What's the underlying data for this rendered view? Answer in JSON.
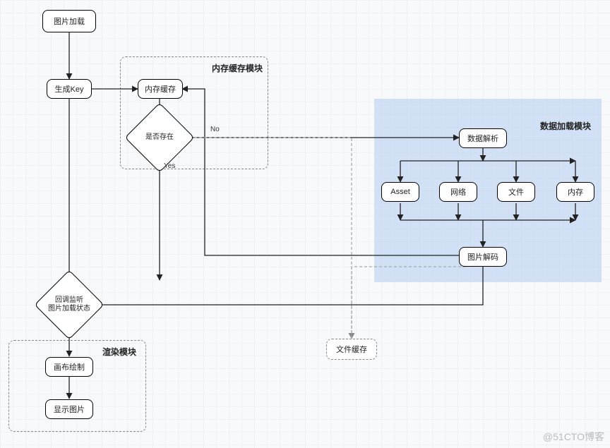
{
  "chart_data": {
    "type": "flowchart",
    "nodes": [
      {
        "id": "start",
        "shape": "rounded-rect",
        "label": "图片加载"
      },
      {
        "id": "genkey",
        "shape": "rounded-rect",
        "label": "生成Key"
      },
      {
        "id": "memcache",
        "shape": "rounded-rect",
        "label": "内存缓存"
      },
      {
        "id": "exists",
        "shape": "diamond",
        "label": "是否存在"
      },
      {
        "id": "parse",
        "shape": "rounded-rect",
        "label": "数据解析"
      },
      {
        "id": "asset",
        "shape": "rounded-rect",
        "label": "Asset"
      },
      {
        "id": "network",
        "shape": "rounded-rect",
        "label": "网络"
      },
      {
        "id": "file",
        "shape": "rounded-rect",
        "label": "文件"
      },
      {
        "id": "mem",
        "shape": "rounded-rect",
        "label": "内存"
      },
      {
        "id": "decode",
        "shape": "rounded-rect",
        "label": "图片解码"
      },
      {
        "id": "callback",
        "shape": "diamond",
        "label": "回调监听\\n图片加载状态"
      },
      {
        "id": "canvas",
        "shape": "rounded-rect",
        "label": "画布绘制"
      },
      {
        "id": "show",
        "shape": "rounded-rect",
        "label": "显示图片"
      },
      {
        "id": "filecache",
        "shape": "dashed-rect",
        "label": "文件缓存"
      }
    ],
    "edges": [
      {
        "from": "start",
        "to": "genkey"
      },
      {
        "from": "genkey",
        "to": "memcache"
      },
      {
        "from": "memcache",
        "to": "exists"
      },
      {
        "from": "exists",
        "to": "parse",
        "label": "No"
      },
      {
        "from": "exists",
        "to": "callback",
        "label": "Yes"
      },
      {
        "from": "parse",
        "to": "asset"
      },
      {
        "from": "parse",
        "to": "network"
      },
      {
        "from": "parse",
        "to": "file"
      },
      {
        "from": "parse",
        "to": "mem"
      },
      {
        "from": "asset",
        "to": "decode"
      },
      {
        "from": "network",
        "to": "decode"
      },
      {
        "from": "file",
        "to": "decode"
      },
      {
        "from": "mem",
        "to": "decode"
      },
      {
        "from": "decode",
        "to": "memcache"
      },
      {
        "from": "decode",
        "to": "callback"
      },
      {
        "from": "decode",
        "to": "filecache",
        "style": "dashed"
      },
      {
        "from": "filecache",
        "to": "exists",
        "style": "dashed"
      },
      {
        "from": "callback",
        "to": "canvas"
      },
      {
        "from": "canvas",
        "to": "show"
      }
    ],
    "modules": [
      {
        "name": "内存缓存模块",
        "contains": [
          "memcache",
          "exists"
        ]
      },
      {
        "name": "数据加载模块",
        "contains": [
          "parse",
          "asset",
          "network",
          "file",
          "mem",
          "decode"
        ],
        "style": "blue"
      },
      {
        "name": "渲染模块",
        "contains": [
          "canvas",
          "show"
        ]
      }
    ]
  },
  "nodes": {
    "start": "图片加载",
    "genkey": "生成Key",
    "memcache": "内存缓存",
    "exists": "是否存在",
    "parse": "数据解析",
    "asset": "Asset",
    "network": "网络",
    "file": "文件",
    "mem": "内存",
    "decode": "图片解码",
    "callback": "回调监听\n图片加载状态",
    "canvas": "画布绘制",
    "show": "显示图片",
    "filecache": "文件缓存"
  },
  "modules": {
    "mem_module": "内存缓存模块",
    "data_module": "数据加载模块",
    "render_module": "渲染模块"
  },
  "edge_labels": {
    "no": "No",
    "yes": "Yes"
  },
  "watermark": "@51CTO博客"
}
